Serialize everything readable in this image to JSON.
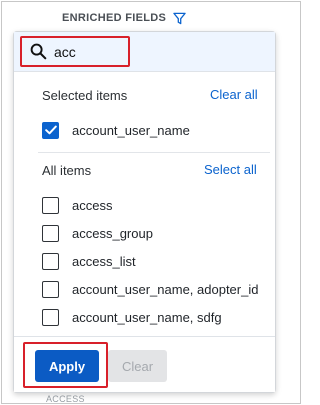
{
  "header": {
    "title": "ENRICHED FIELDS",
    "filter_icon": "filter-icon"
  },
  "background_peek": "ACCESS",
  "search": {
    "icon": "search-icon",
    "value": "acc",
    "placeholder": ""
  },
  "selected_section": {
    "title": "Selected items",
    "clear_all_label": "Clear all",
    "items": [
      {
        "label": "account_user_name",
        "checked": true
      }
    ]
  },
  "all_section": {
    "title": "All items",
    "select_all_label": "Select all",
    "items": [
      {
        "label": "access",
        "checked": false
      },
      {
        "label": "access_group",
        "checked": false
      },
      {
        "label": "access_list",
        "checked": false
      },
      {
        "label": "account_user_name, adopter_id",
        "checked": false
      },
      {
        "label": "account_user_name, sdfg",
        "checked": false
      }
    ]
  },
  "footer": {
    "apply_label": "Apply",
    "clear_label": "Clear"
  },
  "colors": {
    "accent": "#0b63ce",
    "highlight_box": "#d8202a",
    "search_bg": "#eef5ff"
  }
}
